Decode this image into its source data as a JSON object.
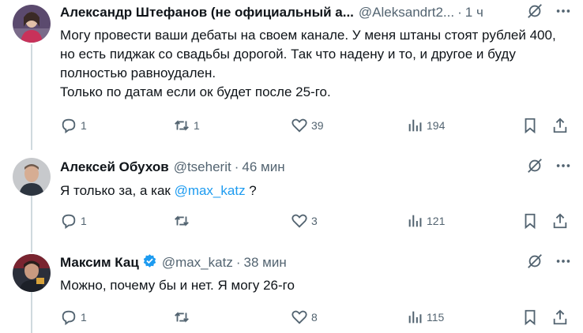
{
  "tweets": [
    {
      "name": "Александр Штефанов (не официальный а...",
      "handle": "@Aleksandrt2...",
      "time": "1 ч",
      "text": "Могу провести ваши дебаты на своем канале. У меня штаны стоят рублей 400, но есть пиджак со свадьбы дорогой. Так что надену и то, и другое и буду полностью равноудален.",
      "text2": "Только по датам если ок будет после 25-го.",
      "replies": "1",
      "retweets": "1",
      "likes": "39",
      "views": "194"
    },
    {
      "name": "Алексей Обухов",
      "handle": "@tseherit",
      "time": "46 мин",
      "text_pre": "Я только за, а как ",
      "mention": "@max_katz",
      "text_post": " ?",
      "replies": "1",
      "retweets": "",
      "likes": "3",
      "views": "121"
    },
    {
      "name": "Максим Кац",
      "handle": "@max_katz",
      "time": "38 мин",
      "text": "Можно, почему бы и нет. Я могу 26-го",
      "replies": "1",
      "retweets": "",
      "likes": "8",
      "views": "115",
      "verified": true
    }
  ],
  "separator": "·",
  "colors": {
    "accent": "#1d9bf0",
    "muted": "#536471",
    "thread_line": "#cfd9de"
  },
  "icons": [
    "grok-icon",
    "more-icon",
    "reply-icon",
    "retweet-icon",
    "like-icon",
    "views-icon",
    "bookmark-icon",
    "share-icon",
    "verified-badge-icon"
  ]
}
